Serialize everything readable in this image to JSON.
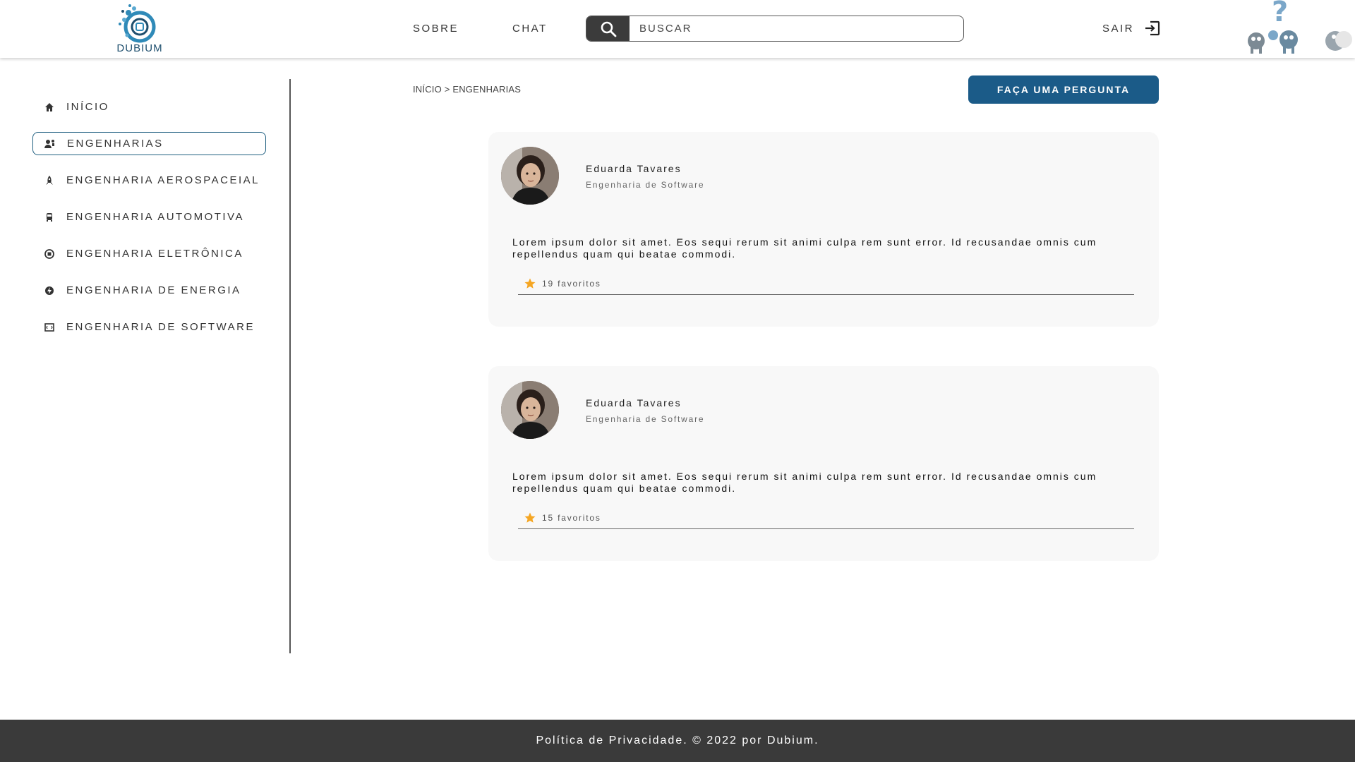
{
  "header": {
    "logo_text": "DUBIUM",
    "nav": [
      {
        "label": "SOBRE"
      },
      {
        "label": "CHAT"
      }
    ],
    "search": {
      "placeholder": "BUSCAR"
    },
    "logout_label": "SAIR"
  },
  "sidebar": {
    "items": [
      {
        "label": "INÍCIO",
        "icon": "home-icon"
      },
      {
        "label": "ENGENHARIAS",
        "icon": "users-icon",
        "active": true
      },
      {
        "label": "ENGENHARIA AEROSPACEIAL",
        "icon": "rocket-icon"
      },
      {
        "label": "ENGENHARIA AUTOMOTIVA",
        "icon": "car-icon"
      },
      {
        "label": "ENGENHARIA ELETRÔNICA",
        "icon": "chip-icon"
      },
      {
        "label": "ENGENHARIA DE ENERGIA",
        "icon": "energy-icon"
      },
      {
        "label": "ENGENHARIA DE SOFTWARE",
        "icon": "code-icon"
      }
    ]
  },
  "main": {
    "breadcrumb": "INÍCIO > ENGENHARIAS",
    "ask_button": "FAÇA UMA PERGUNTA",
    "posts": [
      {
        "author": "Eduarda Tavares",
        "course": "Engenharia de Software",
        "text": "Lorem ipsum dolor sit amet. Eos sequi rerum sit animi culpa rem sunt error. Id recusandae omnis cum repellendus quam qui beatae commodi.",
        "favorites": "19 favoritos"
      },
      {
        "author": "Eduarda Tavares",
        "course": "Engenharia de Software",
        "text": "Lorem ipsum dolor sit amet. Eos sequi rerum sit animi culpa rem sunt error. Id recusandae omnis cum repellendus quam qui beatae commodi.",
        "favorites": "15 favoritos"
      }
    ]
  },
  "footer": {
    "text": "Política de Privacidade. © 2022 por Dubium."
  },
  "colors": {
    "accent": "#1b5b88",
    "active_border": "#1f5f80",
    "search_button": "#3b3b3b",
    "footer_bg": "#3a3a3a",
    "star": "#f5a623",
    "card_bg": "#f8f8f8"
  }
}
